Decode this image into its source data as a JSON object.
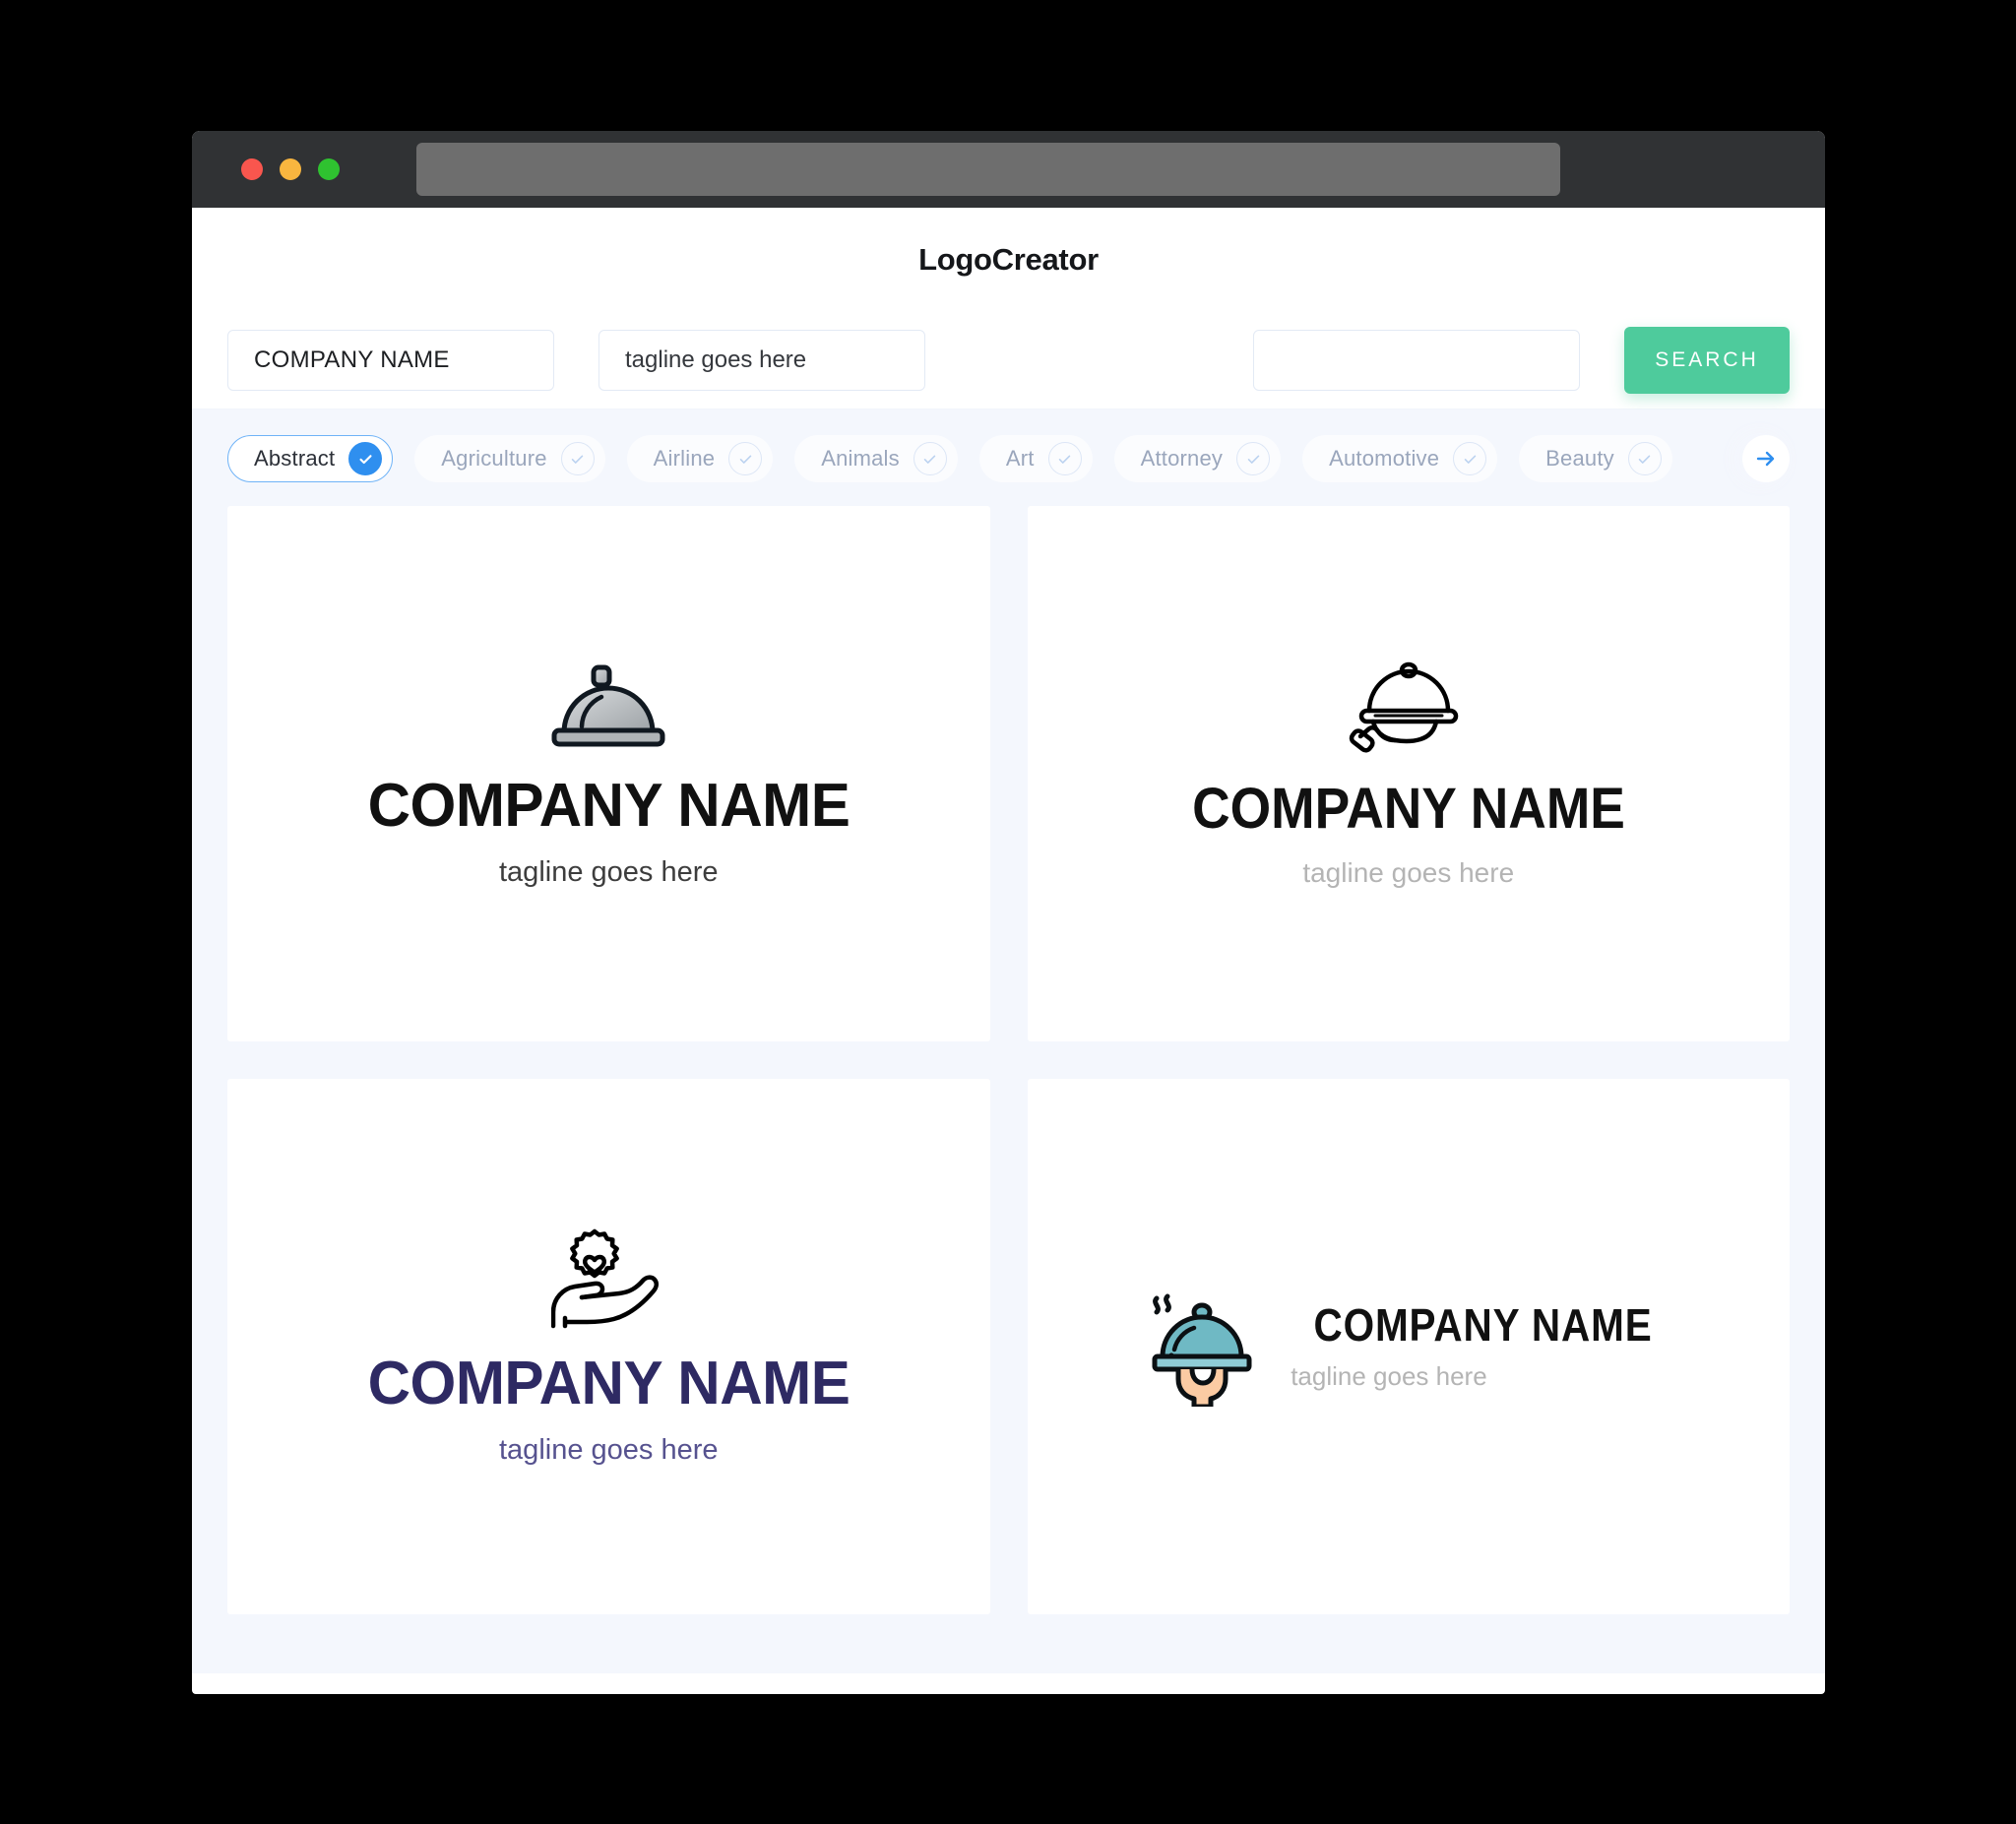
{
  "window": {
    "traffic_lights": [
      "close",
      "minimize",
      "maximize"
    ],
    "url_value": ""
  },
  "header": {
    "title": "LogoCreator"
  },
  "search": {
    "company_value": "COMPANY NAME",
    "company_placeholder": "COMPANY NAME",
    "tagline_value": "tagline goes here",
    "tagline_placeholder": "tagline goes here",
    "keyword_value": "",
    "keyword_placeholder": "",
    "button_label": "SEARCH",
    "button_color": "#4ECB9C"
  },
  "categories": {
    "active": "Abstract",
    "next_label": "next",
    "active_color": "#2F8FEF",
    "items": [
      {
        "label": "Abstract",
        "selected": true
      },
      {
        "label": "Agriculture",
        "selected": false
      },
      {
        "label": "Airline",
        "selected": false
      },
      {
        "label": "Animals",
        "selected": false
      },
      {
        "label": "Art",
        "selected": false
      },
      {
        "label": "Attorney",
        "selected": false
      },
      {
        "label": "Automotive",
        "selected": false
      },
      {
        "label": "Beauty",
        "selected": false
      }
    ]
  },
  "results": {
    "cards": [
      {
        "icon": "silver-cloche-icon",
        "name": "COMPANY NAME",
        "tagline": "tagline goes here",
        "name_color": "#111111",
        "tagline_color": "#3D3D3D",
        "layout": "stacked"
      },
      {
        "icon": "hand-holding-tray-outline-icon",
        "name": "COMPANY NAME",
        "tagline": "tagline goes here",
        "name_color": "#111111",
        "tagline_color": "#B4B4B4",
        "layout": "stacked"
      },
      {
        "icon": "hand-holding-gear-heart-icon",
        "name": "COMPANY NAME",
        "tagline": "tagline goes here",
        "name_color": "#2E2A63",
        "tagline_color": "#56528F",
        "layout": "stacked"
      },
      {
        "icon": "teal-cloche-hand-icon",
        "name": "COMPANY NAME",
        "tagline": "tagline goes here",
        "name_color": "#111111",
        "tagline_color": "#B4B4B4",
        "layout": "horizontal"
      }
    ]
  },
  "theme": {
    "page_background": "#F4F7FD",
    "card_background": "#FFFFFF",
    "titlebar": "#303234",
    "urlbar": "#6E6E6E"
  }
}
